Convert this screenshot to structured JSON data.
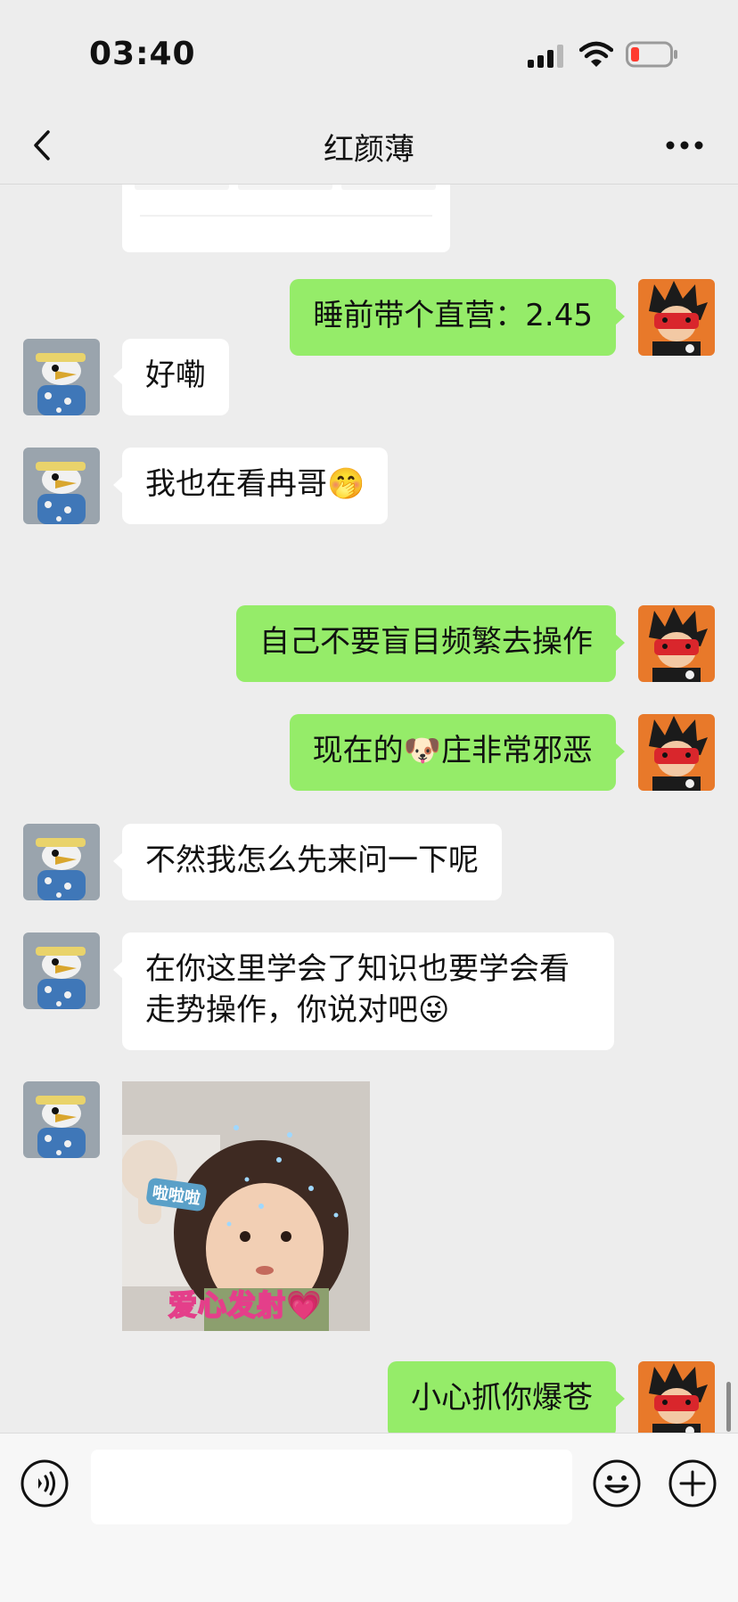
{
  "status_bar": {
    "time": "03:40"
  },
  "nav": {
    "title": "红颜薄"
  },
  "messages": [
    {
      "side": "right",
      "text": "睡前带个直营：2.45"
    },
    {
      "side": "left",
      "text": "好嘞"
    },
    {
      "side": "left",
      "text": "我也在看冉哥🤭"
    },
    {
      "side": "right",
      "text": "自己不要盲目频繁去操作"
    },
    {
      "side": "right",
      "text": "现在的🐶庄非常邪恶"
    },
    {
      "side": "left",
      "text": "不然我怎么先来问一下呢"
    },
    {
      "side": "left",
      "text": "在你这里学会了知识也要学会看\n走势操作，你说对吧😜"
    },
    {
      "side": "left",
      "sticker": {
        "caption_top": "啦啦啦",
        "caption": "爱心发射💗"
      }
    },
    {
      "side": "right",
      "text": "小心抓你爆苍"
    }
  ],
  "icons": {
    "back": "chevron-left-icon",
    "more": "more-icon",
    "voice": "voice-icon",
    "emoji": "emoji-icon",
    "plus": "plus-icon"
  },
  "colors": {
    "bubble_right": "#95ec69",
    "bubble_left": "#ffffff",
    "background": "#ededed"
  }
}
